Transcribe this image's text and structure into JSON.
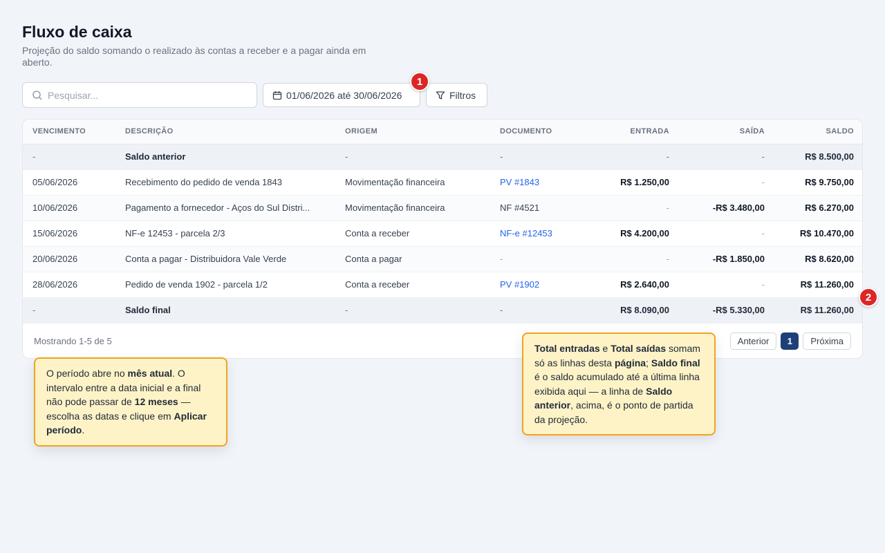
{
  "header": {
    "title": "Fluxo de caixa",
    "subtitle": "Projeção do saldo somando o realizado às contas a receber e a pagar ainda em aberto."
  },
  "toolbar": {
    "search_placeholder": "Pesquisar...",
    "date_range": "01/06/2026 até 30/06/2026",
    "filter_label": "Filtros"
  },
  "markers": {
    "m1": "1",
    "m2": "2"
  },
  "table": {
    "headers": [
      "VENCIMENTO",
      "DESCRIÇÃO",
      "ORIGEM",
      "DOCUMENTO",
      "ENTRADA",
      "SAÍDA",
      "SALDO"
    ],
    "opening": [
      "-",
      "Saldo anterior",
      "-",
      "-",
      "-",
      "-",
      "R$ 8.500,00"
    ],
    "rows": [
      [
        "05/06/2026",
        "Recebimento do pedido de venda 1843",
        "Movimentação financeira",
        "PV #1843",
        "R$ 1.250,00",
        "-",
        "R$ 9.750,00"
      ],
      [
        "10/06/2026",
        "Pagamento a fornecedor - Aços do Sul Distri...",
        "Movimentação financeira",
        "NF #4521",
        "-",
        "-R$ 3.480,00",
        "R$ 6.270,00"
      ],
      [
        "15/06/2026",
        "NF-e 12453 - parcela 2/3",
        "Conta a receber",
        "NF-e #12453",
        "R$ 4.200,00",
        "-",
        "R$ 10.470,00"
      ],
      [
        "20/06/2026",
        "Conta a pagar - Distribuidora Vale Verde",
        "Conta a pagar",
        "-",
        "-",
        "-R$ 1.850,00",
        "R$ 8.620,00"
      ],
      [
        "28/06/2026",
        "Pedido de venda 1902 - parcela 1/2",
        "Conta a receber",
        "PV #1902",
        "R$ 2.640,00",
        "-",
        "R$ 11.260,00"
      ]
    ],
    "closing": [
      "-",
      "Saldo final",
      "-",
      "-",
      "R$ 8.090,00",
      "-R$ 5.330,00",
      "R$ 11.260,00"
    ]
  },
  "footer": {
    "showing": "Mostrando 1-5 de 5",
    "prev": "Anterior",
    "page": "1",
    "next": "Próxima"
  },
  "notes": {
    "left": [
      {
        "t": "O período abre no "
      },
      {
        "t": "mês atual",
        "b": true
      },
      {
        "t": ". O intervalo entre a data inicial e a final não pode passar de "
      },
      {
        "t": "12 meses",
        "b": true
      },
      {
        "t": " — escolha as datas e clique em "
      },
      {
        "t": "Aplicar período",
        "b": true
      },
      {
        "t": "."
      }
    ],
    "right": [
      {
        "t": "Total entradas",
        "b": true
      },
      {
        "t": " e "
      },
      {
        "t": "Total saídas",
        "b": true
      },
      {
        "t": " somam só as linhas desta "
      },
      {
        "t": "página",
        "b": true
      },
      {
        "t": "; "
      },
      {
        "t": "Saldo final",
        "b": true
      },
      {
        "t": " é o saldo acumulado até a última linha exibida aqui — a linha de "
      },
      {
        "t": "Saldo anterior",
        "b": true
      },
      {
        "t": ", acima, é o ponto de partida da projeção."
      }
    ]
  },
  "colors": {
    "accent": "#1e4079",
    "link": "#2563eb",
    "marker": "#dc2626",
    "note_border": "#f0a323",
    "note_bg": "#fef3c7"
  }
}
